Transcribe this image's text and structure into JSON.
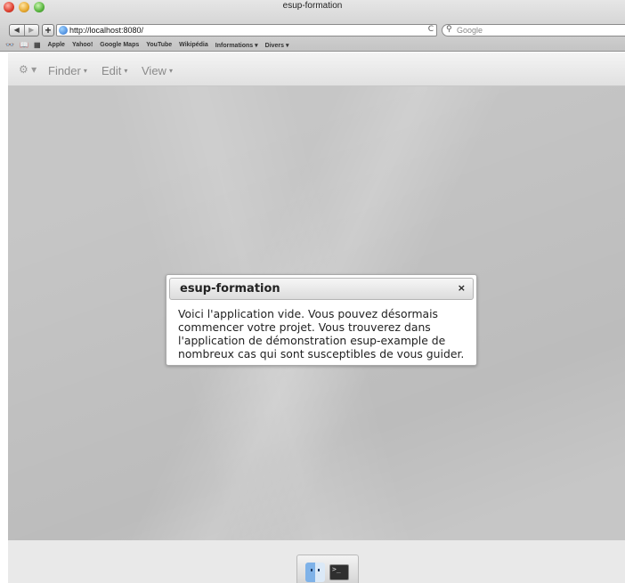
{
  "window": {
    "title": "esup-formation"
  },
  "toolbar": {
    "back_glyph": "◀",
    "forward_glyph": "▶",
    "add_glyph": "+",
    "url": "http://localhost:8080/",
    "reload_glyph": "C",
    "search_placeholder": "Google"
  },
  "bookmarks": {
    "items": [
      "Apple",
      "Yahoo!",
      "Google Maps",
      "YouTube",
      "Wikipédia",
      "Informations ▾",
      "Divers ▾"
    ]
  },
  "desktop": {
    "menubar": {
      "apple_glyph": "⚙ ▾",
      "items": [
        {
          "label": "Finder",
          "caret": "▾"
        },
        {
          "label": "Edit",
          "caret": "▾"
        },
        {
          "label": "View",
          "caret": "▾"
        }
      ]
    },
    "dialog": {
      "title": "esup-formation",
      "close_glyph": "×",
      "message": "Voici l'application vide. Vous pouvez désormais commencer votre projet. Vous trouverez dans l'application de démonstration esup-example de nombreux cas qui sont susceptibles de vous guider."
    },
    "dock": {
      "terminal_prompt": ">_"
    }
  }
}
